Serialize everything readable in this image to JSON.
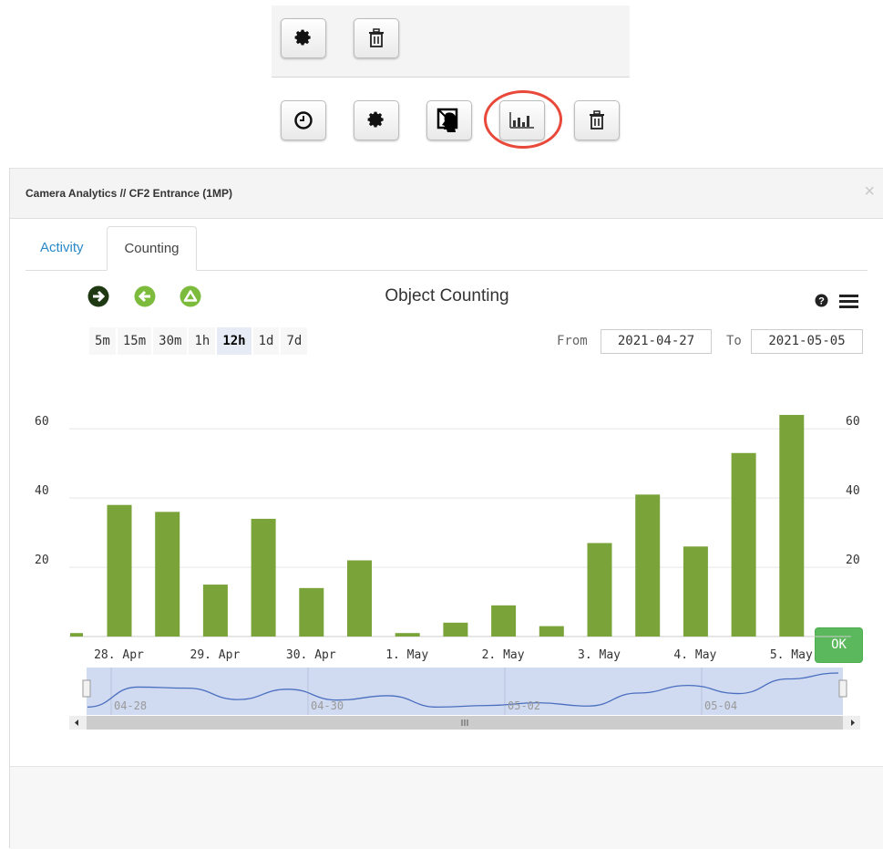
{
  "toolbar": {
    "top_buttons": [
      "settings",
      "delete"
    ],
    "bottom_buttons": [
      "schedule",
      "settings",
      "privacy-mask",
      "analytics",
      "delete"
    ]
  },
  "modal": {
    "title": "Camera Analytics // CF2 Entrance (1MP)",
    "close": "×",
    "tabs": [
      "Activity",
      "Counting"
    ],
    "active_tab": "Counting"
  },
  "chart_title": "Object Counting",
  "range_buttons": [
    "5m",
    "15m",
    "30m",
    "1h",
    "12h",
    "1d",
    "7d"
  ],
  "active_range": "12h",
  "from_label": "From",
  "from_value": "2021-04-27",
  "to_label": "To",
  "to_value": "2021-05-05",
  "ok_label": "OK",
  "colors": {
    "bar": "#7aa33a",
    "nav_area": "#d0daf0",
    "nav_line": "#4a6fc0",
    "link": "#2a89c8",
    "ok": "#5cb85c"
  },
  "chart_data": {
    "type": "bar",
    "title": "Object Counting",
    "xlabel": "",
    "ylabel": "",
    "ylim": [
      0,
      64
    ],
    "yticks": [
      20,
      40,
      60
    ],
    "x_tick_labels": [
      "28. Apr",
      "29. Apr",
      "30. Apr",
      "1. May",
      "2. May",
      "3. May",
      "4. May",
      "5. May"
    ],
    "categories": [
      "2021-04-27 12:00",
      "2021-04-28 00:00",
      "2021-04-28 12:00",
      "2021-04-29 00:00",
      "2021-04-29 12:00",
      "2021-04-30 00:00",
      "2021-04-30 12:00",
      "2021-05-01 00:00",
      "2021-05-01 12:00",
      "2021-05-02 00:00",
      "2021-05-02 12:00",
      "2021-05-03 00:00",
      "2021-05-03 12:00",
      "2021-05-04 00:00",
      "2021-05-04 12:00",
      "2021-05-05 00:00"
    ],
    "values": [
      1,
      38,
      36,
      15,
      34,
      14,
      22,
      1,
      4,
      9,
      3,
      27,
      41,
      26,
      53,
      64
    ],
    "navigator_labels": [
      "04-28",
      "04-30",
      "05-02",
      "05-04"
    ],
    "grid": true
  }
}
